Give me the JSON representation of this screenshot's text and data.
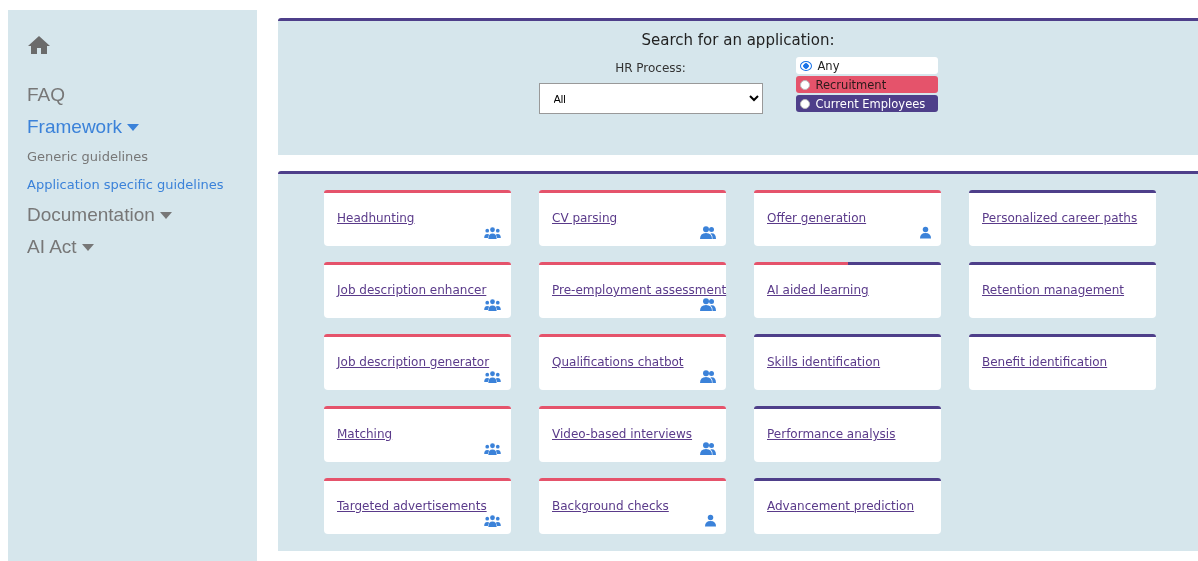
{
  "sidebar": {
    "items": [
      {
        "label": "FAQ",
        "selected": false,
        "dropdown": false
      },
      {
        "label": "Framework",
        "selected": true,
        "dropdown": true,
        "children": [
          {
            "label": "Generic guidelines",
            "selected": false
          },
          {
            "label": "Application specific guidelines",
            "selected": true
          }
        ]
      },
      {
        "label": "Documentation",
        "selected": false,
        "dropdown": true
      },
      {
        "label": "AI Act",
        "selected": false,
        "dropdown": true
      }
    ]
  },
  "search": {
    "title": "Search for an application:",
    "hr_process": {
      "label": "HR Process:",
      "value": "All"
    },
    "options": [
      {
        "label": "Any",
        "selected": true,
        "color": "#ffffff"
      },
      {
        "label": "Recruitment",
        "selected": false,
        "color": "#e5536b"
      },
      {
        "label": "Current Employees",
        "selected": false,
        "color": "#4e3f8a"
      }
    ]
  },
  "applications": [
    [
      {
        "label": "Headhunting",
        "kind": "group",
        "segments": [
          {
            "color": "#e5536b"
          }
        ]
      },
      {
        "label": "Job description enhancer",
        "kind": "group",
        "segments": [
          {
            "color": "#e5536b"
          }
        ]
      },
      {
        "label": "Job description generator",
        "kind": "group",
        "segments": [
          {
            "color": "#e5536b"
          }
        ]
      },
      {
        "label": "Matching",
        "kind": "group",
        "segments": [
          {
            "color": "#e5536b"
          }
        ]
      },
      {
        "label": "Targeted advertisements",
        "kind": "group",
        "segments": [
          {
            "color": "#e5536b"
          }
        ]
      }
    ],
    [
      {
        "label": "CV parsing",
        "kind": "pair",
        "segments": [
          {
            "color": "#e5536b"
          }
        ]
      },
      {
        "label": "Pre-employment assessment",
        "kind": "pair",
        "segments": [
          {
            "color": "#e5536b"
          }
        ]
      },
      {
        "label": "Qualifications chatbot",
        "kind": "pair",
        "segments": [
          {
            "color": "#e5536b"
          }
        ]
      },
      {
        "label": "Video-based interviews",
        "kind": "pair",
        "segments": [
          {
            "color": "#e5536b"
          }
        ]
      },
      {
        "label": "Background checks",
        "kind": "person",
        "segments": [
          {
            "color": "#e5536b"
          }
        ]
      }
    ],
    [
      {
        "label": "Offer generation",
        "kind": "person",
        "segments": [
          {
            "color": "#e5536b"
          }
        ]
      },
      {
        "label": "AI aided learning",
        "kind": "plain",
        "segments": [
          {
            "color": "#e5536b"
          },
          {
            "color": "#4e3f8a"
          }
        ]
      },
      {
        "label": "Skills identification",
        "kind": "plain",
        "segments": [
          {
            "color": "#4e3f8a"
          }
        ]
      },
      {
        "label": "Performance analysis",
        "kind": "plain",
        "segments": [
          {
            "color": "#4e3f8a"
          }
        ]
      },
      {
        "label": "Advancement prediction",
        "kind": "plain",
        "segments": [
          {
            "color": "#4e3f8a"
          }
        ]
      }
    ],
    [
      {
        "label": "Personalized career paths",
        "kind": "plain",
        "segments": [
          {
            "color": "#4e3f8a"
          }
        ]
      },
      {
        "label": "Retention management",
        "kind": "plain",
        "segments": [
          {
            "color": "#4e3f8a"
          }
        ]
      },
      {
        "label": "Benefit identification",
        "kind": "plain",
        "segments": [
          {
            "color": "#4e3f8a"
          }
        ]
      }
    ]
  ]
}
